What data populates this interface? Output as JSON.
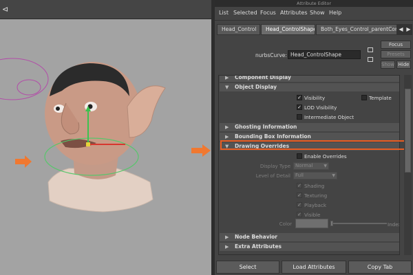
{
  "viewport": {
    "toolbar_icon": "share-icon"
  },
  "attribute_editor": {
    "title": "Attribute Editor",
    "menu": [
      "List",
      "Selected",
      "Focus",
      "Attributes",
      "Show",
      "Help"
    ],
    "tabs": [
      "Head_Control",
      "Head_ControlShape",
      "Both_Eyes_Control_parentConstr"
    ],
    "node_type_label": "nurbsCurve:",
    "node_name": "Head_ControlShape",
    "side_buttons": {
      "focus": "Focus",
      "presets": "Presets",
      "show": "Show",
      "hide": "Hide"
    },
    "sections": {
      "component_display": "Component Display",
      "object_display": "Object Display",
      "ghosting": "Ghosting Information",
      "bounding_box": "Bounding Box Information",
      "drawing_overrides": "Drawing Overrides",
      "node_behavior": "Node Behavior",
      "extra_attributes": "Extra Attributes"
    },
    "object_display": {
      "visibility": "Visibility",
      "template": "Template",
      "lod_visibility": "LOD Visibility",
      "intermediate_object": "Intermediate Object"
    },
    "drawing_overrides": {
      "enable_overrides": "Enable Overrides",
      "display_type_label": "Display Type",
      "display_type_value": "Normal",
      "level_of_detail_label": "Level of Detail",
      "level_of_detail_value": "Full",
      "shading": "Shading",
      "texturing": "Texturing",
      "playback": "Playback",
      "visible": "Visible",
      "color_label": "Color",
      "index_label": "Index"
    },
    "bottom_buttons": {
      "select": "Select",
      "load_attributes": "Load Attributes",
      "copy_tab": "Copy Tab"
    }
  },
  "colors": {
    "highlight": "#ea5d22",
    "arrow": "#f07830",
    "viewport_bg": "#a3a3a3"
  }
}
